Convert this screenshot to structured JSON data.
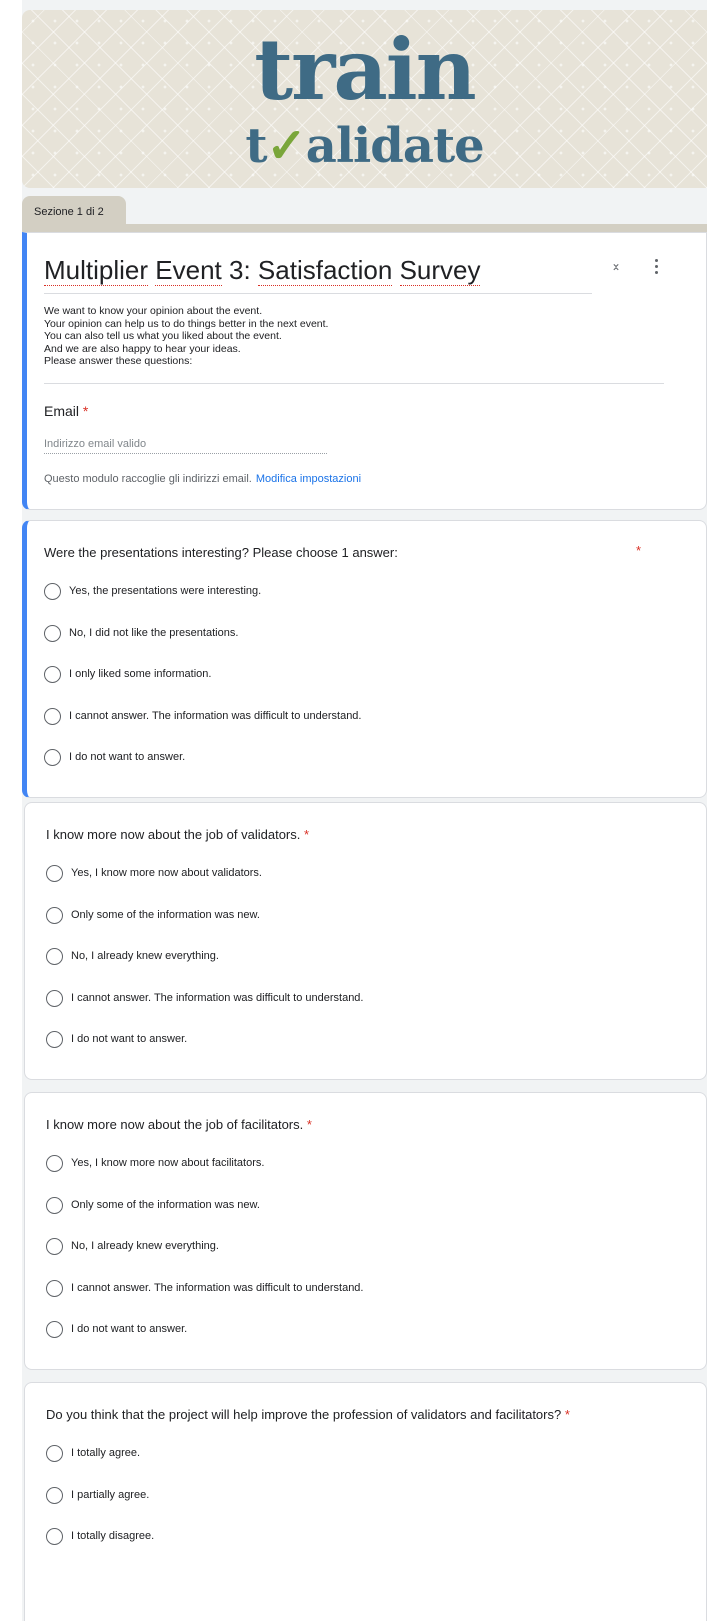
{
  "banner": {
    "logo_top": "train",
    "logo_bottom_pre": "t",
    "logo_bottom_check": "✓",
    "logo_bottom_post": "alidate"
  },
  "section_tab": "Sezione 1 di 2",
  "header": {
    "title_words": [
      "Multiplier",
      "Event",
      "3:",
      "Satisfaction",
      "Survey"
    ],
    "description": [
      "We want to know your opinion about the event.",
      "Your opinion can help us to do things better in the next event.",
      "You can also tell us what you liked about the event.",
      "And we are also happy to hear your ideas.",
      "Please answer these questions:"
    ],
    "email_label": "Email",
    "required_mark": "*",
    "email_placeholder": "Indirizzo email valido",
    "collect_note": "Questo modulo raccoglie gli indirizzi email.",
    "settings_link": "Modifica impostazioni"
  },
  "questions": [
    {
      "title": "Were the presentations interesting? Please choose 1 answer:",
      "options": [
        "Yes, the presentations were interesting.",
        "No, I did not like the presentations.",
        "I only liked some information.",
        "I cannot answer. The information was difficult to understand.",
        "I do not want to answer."
      ]
    },
    {
      "title": "I know more now about the job of validators.",
      "options": [
        "Yes, I know more now about validators.",
        "Only some of the information was new.",
        "No, I already knew everything.",
        "I cannot answer. The information was difficult to understand.",
        "I do not want to answer."
      ]
    },
    {
      "title": "I know more now about the job of facilitators.",
      "options": [
        "Yes, I know more now about facilitators.",
        "Only some of the information was new.",
        "No, I already knew everything.",
        "I cannot answer. The information was difficult to understand.",
        "I do not want to answer."
      ]
    },
    {
      "title": "Do you think that the project will help improve the profession of validators and facilitators?",
      "options": [
        "I totally agree.",
        "I partially agree.",
        "I totally disagree."
      ]
    }
  ],
  "colors": {
    "accent": "#4285f4",
    "required": "#d93025",
    "link": "#1a73e8",
    "logo": "#3f6b85",
    "check": "#7aa63a"
  }
}
